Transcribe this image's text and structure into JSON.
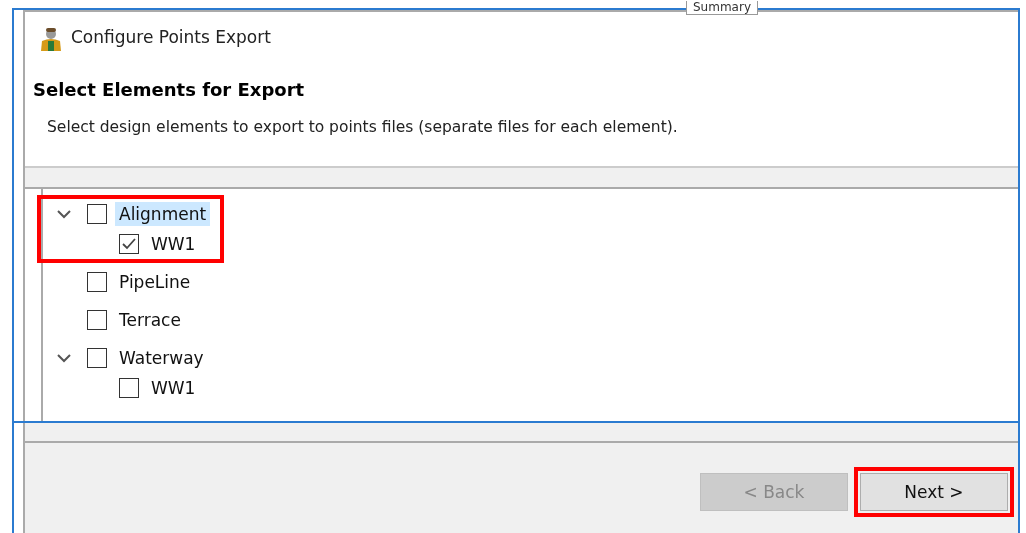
{
  "background_tab": {
    "label": "Summary"
  },
  "window": {
    "title": "Configure Points Export"
  },
  "header": {
    "title": "Select Elements for Export",
    "description": "Select design elements to export to points files (separate files for each element)."
  },
  "tree": [
    {
      "label": "Alignment",
      "checked": false,
      "expanded": true,
      "selected": true,
      "outlined": true,
      "children": [
        {
          "label": "WW1",
          "checked": true,
          "selected": false
        }
      ]
    },
    {
      "label": "PipeLine",
      "checked": false,
      "selected": false,
      "outlined": false
    },
    {
      "label": "Terrace",
      "checked": false,
      "selected": false,
      "outlined": false
    },
    {
      "label": "Waterway",
      "checked": false,
      "expanded": true,
      "selected": false,
      "outlined": false,
      "children": [
        {
          "label": "WW1",
          "checked": false,
          "selected": false
        }
      ]
    }
  ],
  "buttons": [
    {
      "label": "< Back",
      "disabled": true,
      "outlined": false
    },
    {
      "label": "Next >",
      "disabled": false,
      "outlined": true
    }
  ]
}
